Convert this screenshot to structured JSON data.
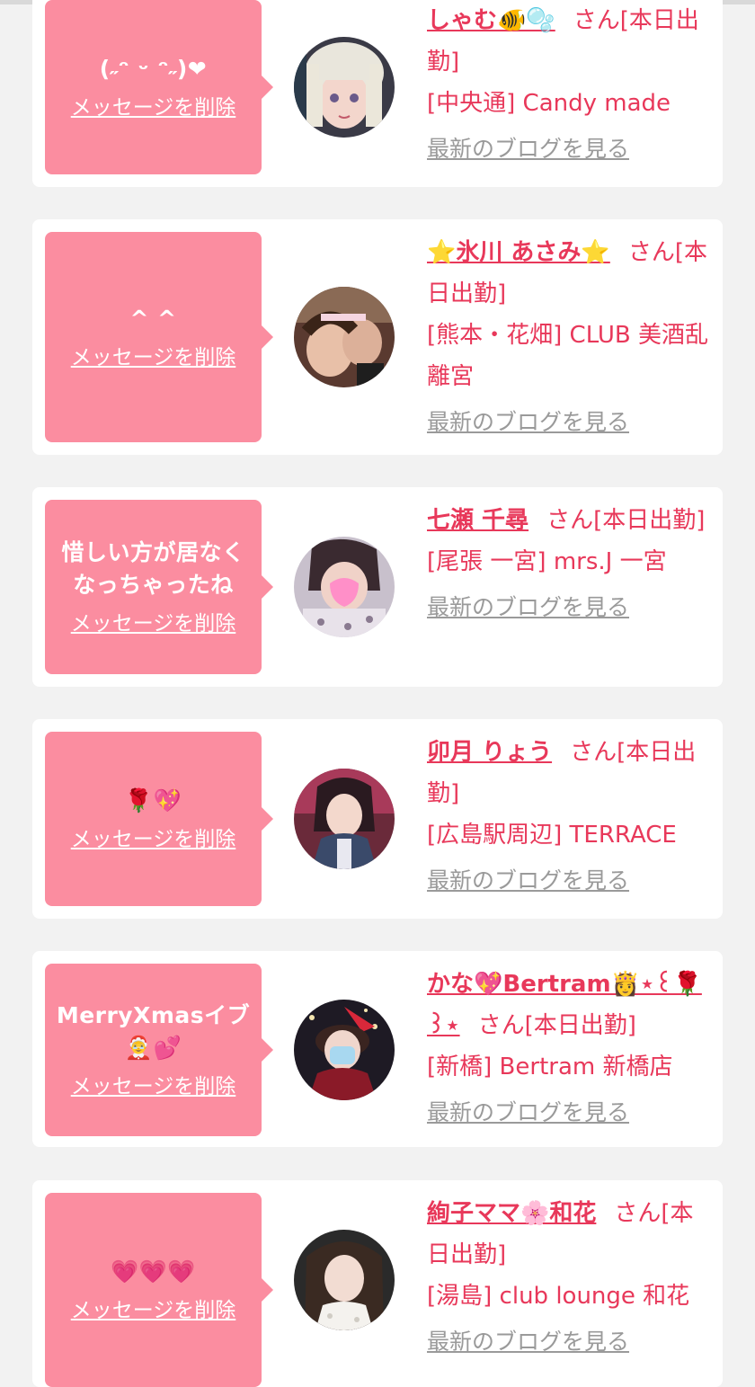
{
  "items": [
    {
      "message": "(˶ᵔ ᵕ ᵔ˶)❤",
      "delete_label": "メッセージを削除",
      "name": "しゃむ🐠🫧",
      "suffix": "さん[本日出勤]",
      "shop": "[中央通] Candy made",
      "blog_label": "最新のブログを見る"
    },
    {
      "message": "^ ^",
      "delete_label": "メッセージを削除",
      "name": "⭐氷川 あさみ⭐",
      "suffix": "さん[本日出勤]",
      "shop": "[熊本・花畑] CLUB 美酒乱 離宮",
      "blog_label": "最新のブログを見る"
    },
    {
      "message": "惜しい方が居なくなっちゃったね",
      "delete_label": "メッセージを削除",
      "name": "七瀬 千尋",
      "suffix": "さん[本日出勤]",
      "shop": "[尾張 一宮] mrs.J 一宮",
      "blog_label": "最新のブログを見る"
    },
    {
      "message": "🌹💖",
      "delete_label": "メッセージを削除",
      "name": "卯月 りょう",
      "suffix": "さん[本日出勤]",
      "shop": "[広島駅周辺] TERRACE",
      "blog_label": "最新のブログを見る"
    },
    {
      "message": "MerryXmasイブ🤶💕",
      "delete_label": "メッセージを削除",
      "name": "かな💖Bertram👸⋆꒰🌹꒱⋆",
      "suffix": "さん[本日出勤]",
      "shop": "[新橋] Bertram 新橋店",
      "blog_label": "最新のブログを見る"
    },
    {
      "message": "💗💗💗",
      "delete_label": "メッセージを削除",
      "name": "絢子ママ🌸和花",
      "suffix": "さん[本日出勤]",
      "shop": "[湯島] club lounge 和花",
      "blog_label": "最新のブログを見る"
    }
  ],
  "colors": {
    "bubble": "#fb8da0",
    "accent": "#e8385a",
    "muted": "#9a9a9a",
    "page_bg": "#f2f2f2"
  }
}
